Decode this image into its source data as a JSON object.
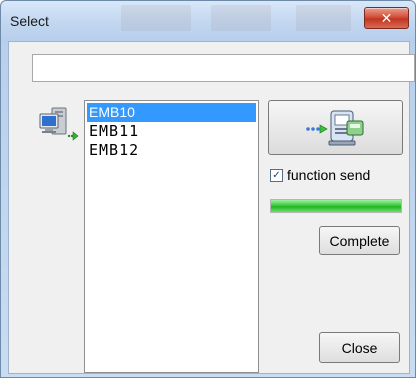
{
  "window": {
    "title": "Select",
    "close_glyph": "✕"
  },
  "path_field": {
    "value": ""
  },
  "device_list": {
    "items": [
      {
        "label": "EMB10",
        "selected": true
      },
      {
        "label": "EMB11",
        "selected": false
      },
      {
        "label": "EMB12",
        "selected": false
      }
    ]
  },
  "icons": {
    "pc": "pc-network-icon",
    "send": "send-to-device-icon",
    "check": "checkmark-icon"
  },
  "options": {
    "function_send_label": "function send",
    "function_send_checked": true,
    "check_glyph": "✓"
  },
  "progress": {
    "fraction": 1.0,
    "color": "#2ec42e"
  },
  "buttons": {
    "complete_label": "Complete",
    "close_label": "Close"
  }
}
